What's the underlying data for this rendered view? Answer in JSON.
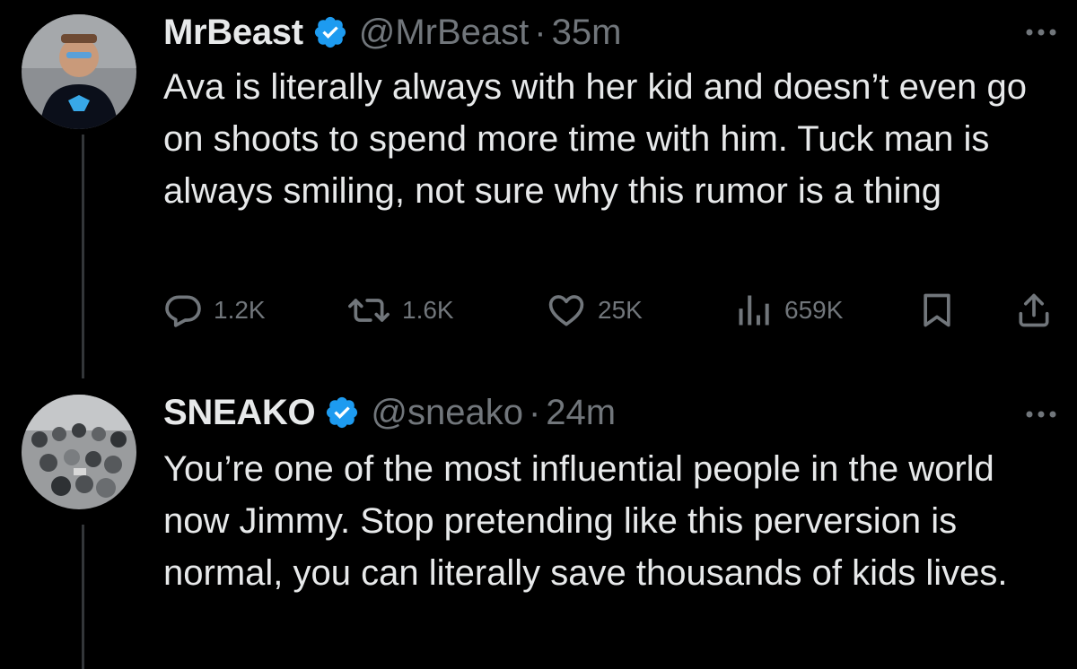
{
  "tweets": [
    {
      "name": "MrBeast",
      "handle": "@MrBeast",
      "separator": "·",
      "time": "35m",
      "text": "Ava is literally always with her kid and doesn’t even go on shoots to spend more time with him. Tuck man is always smiling, not sure why this rumor is a thing",
      "replies": "1.2K",
      "reposts": "1.6K",
      "likes": "25K",
      "views": "659K"
    },
    {
      "name": "SNEAKO",
      "handle": "@sneako",
      "separator": "·",
      "time": "24m",
      "text": "You’re one of the most influential people in the world now Jimmy. Stop pretending like this perversion is normal, you can literally save thousands of kids lives."
    }
  ],
  "colors": {
    "background": "#000000",
    "primary_text": "#e7e9ea",
    "secondary_text": "#71767b",
    "verified_badge": "#1d9bf0",
    "thread_line": "#333639"
  },
  "icons": [
    "reply-icon",
    "repost-icon",
    "like-icon",
    "views-icon",
    "bookmark-icon",
    "share-icon",
    "more-icon",
    "verified-badge-icon"
  ]
}
